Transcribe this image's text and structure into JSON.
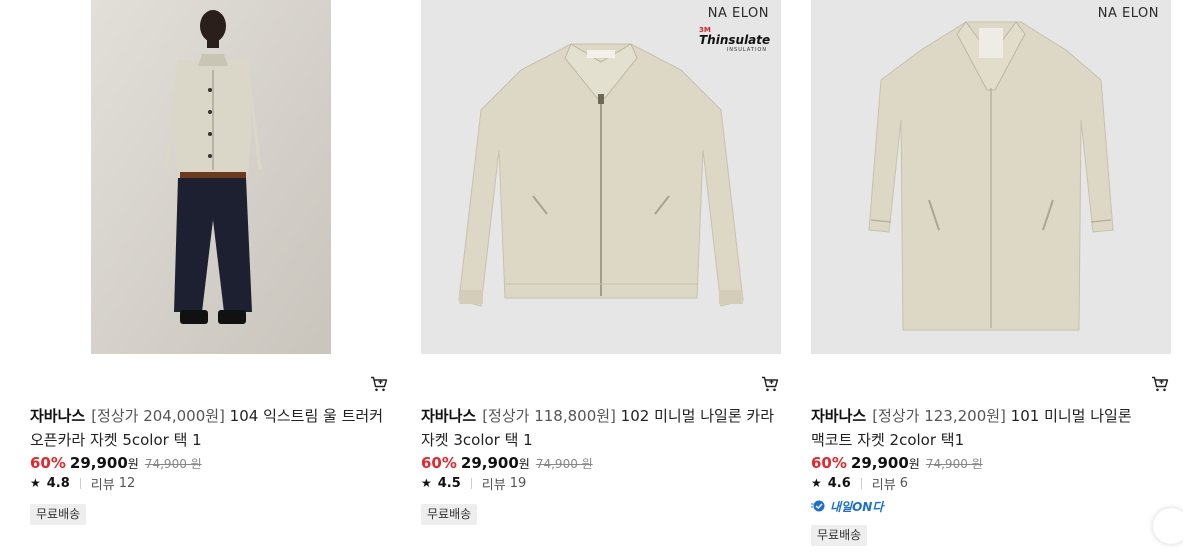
{
  "products": [
    {
      "brand": "자바나스",
      "name_prefix": "[정상가 204,000원]",
      "name_rest": " 104 익스트림 울 트러커 오픈카라 자켓 5color 택 1",
      "discount": "60%",
      "sale_price": "29,900",
      "sale_unit": "원",
      "original_price": "74,900 원",
      "rating": "4.8",
      "review_label": "리뷰",
      "review_count": "12",
      "badge": "무료배송",
      "brand_mark": "",
      "image": "model-wearing-jacket-photo"
    },
    {
      "brand": "자바나스",
      "name_prefix": "[정상가 118,800원]",
      "name_rest": " 102 미니멀 나일론 카라 자켓 3color 택 1",
      "discount": "60%",
      "sale_price": "29,900",
      "sale_unit": "원",
      "original_price": "74,900 원",
      "rating": "4.5",
      "review_label": "리뷰",
      "review_count": "19",
      "badge": "무료배송",
      "brand_mark": "NA ELON",
      "insulation": {
        "m3": "3M",
        "name": "Thinsulate",
        "sub": "INSULATION"
      },
      "image": "zip-jacket-product-photo"
    },
    {
      "brand": "자바나스",
      "name_prefix": "[정상가 123,200원]",
      "name_rest": " 101 미니멀 나일론 맥코트 자켓 2color 택1",
      "discount": "60%",
      "sale_price": "29,900",
      "sale_unit": "원",
      "original_price": "74,900 원",
      "rating": "4.6",
      "review_label": "리뷰",
      "review_count": "6",
      "delivery_tag": "내일ON다",
      "badge": "무료배송",
      "brand_mark": "NA ELON",
      "image": "mac-coat-product-photo"
    }
  ],
  "colors": {
    "discount": "#e8262b",
    "jacket_beige": "#ddd8c6",
    "image_bg": "#e6e6e6",
    "tomorrow_blue": "#1a6fd6"
  }
}
